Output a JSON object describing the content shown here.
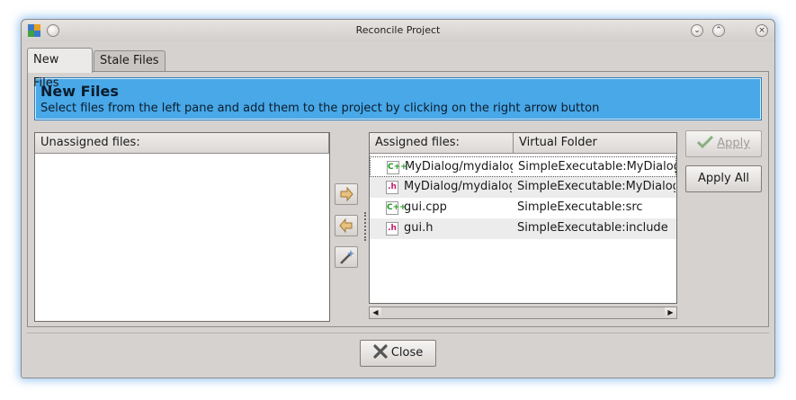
{
  "window": {
    "title": "Reconcile Project"
  },
  "tabs": [
    {
      "label": "New Files",
      "active": true
    },
    {
      "label": "Stale Files",
      "active": false
    }
  ],
  "banner": {
    "title": "New Files",
    "text": "Select files from the left pane and add them to the project by clicking on the right arrow button"
  },
  "unassigned": {
    "header": "Unassigned files:"
  },
  "assigned": {
    "headers": [
      "Assigned files:",
      "Virtual Folder"
    ],
    "rows": [
      {
        "file": "MyDialog/mydialog",
        "folder": "SimpleExecutable:MyDialog",
        "icon": "cpp-file-icon",
        "badge": "C++"
      },
      {
        "file": "MyDialog/mydialog",
        "folder": "SimpleExecutable:MyDialog",
        "icon": "header-file-icon",
        "badge": ".h"
      },
      {
        "file": "gui.cpp",
        "folder": "SimpleExecutable:src",
        "icon": "cpp-file-icon",
        "badge": "C++"
      },
      {
        "file": "gui.h",
        "folder": "SimpleExecutable:include",
        "icon": "header-file-icon",
        "badge": ".h"
      }
    ]
  },
  "buttons": {
    "apply": "Apply",
    "apply_all": "Apply All",
    "close": "Close"
  },
  "colors": {
    "banner": "#48a8e8",
    "window_bg": "#d6d2d0",
    "cpp_icon": "#1c9a1c",
    "header_icon": "#c01a6a"
  }
}
